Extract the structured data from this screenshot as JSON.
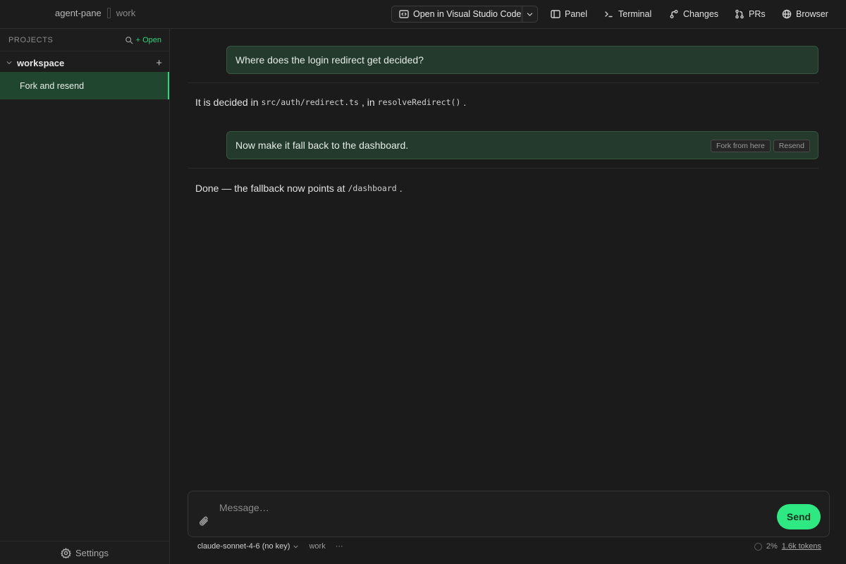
{
  "header": {
    "project": "agent-pane",
    "branch": "work",
    "open_editor_label": "Open in Visual Studio Code",
    "actions": [
      {
        "label": "Panel",
        "icon": "panel-icon"
      },
      {
        "label": "Terminal",
        "icon": "terminal-icon"
      },
      {
        "label": "Changes",
        "icon": "changes-icon"
      },
      {
        "label": "PRs",
        "icon": "pull-request-icon"
      },
      {
        "label": "Browser",
        "icon": "globe-icon"
      }
    ]
  },
  "sidebar": {
    "title": "PROJECTS",
    "open_label": "+ Open",
    "workspace": "workspace",
    "sessions": [
      {
        "label": "Fork and resend",
        "active": true
      }
    ],
    "settings_label": "Settings"
  },
  "chat": {
    "messages": [
      {
        "role": "user",
        "text": "Where does the login redirect get decided?"
      },
      {
        "role": "assistant",
        "parts": [
          "It is decided in",
          "src/auth/redirect.ts",
          ", in",
          "resolveRedirect()",
          "."
        ]
      },
      {
        "role": "user",
        "text": "Now make it fall back to the dashboard.",
        "actions": [
          "Fork from here",
          "Resend"
        ]
      },
      {
        "role": "assistant",
        "parts": [
          "Done — the fallback now points at",
          "/dashboard",
          "."
        ]
      }
    ]
  },
  "composer": {
    "placeholder": "Message…",
    "send_label": "Send",
    "model": "claude-sonnet-4-6 (no key)",
    "branch": "work",
    "more": "···",
    "context_percent": "2%",
    "tokens": "1.6k tokens"
  },
  "colors": {
    "accent": "#2ee882",
    "active_session_bg": "#21462f",
    "user_bubble_bg": "#243a2c"
  }
}
